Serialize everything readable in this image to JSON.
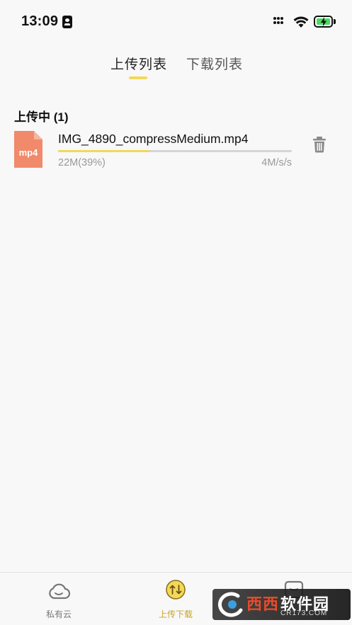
{
  "status_bar": {
    "time": "13:09"
  },
  "tabs": [
    {
      "label": "上传列表",
      "active": true
    },
    {
      "label": "下载列表",
      "active": false
    }
  ],
  "section": {
    "title": "上传中 (1)"
  },
  "uploads": [
    {
      "file_type": "mp4",
      "name": "IMG_4890_compressMedium.mp4",
      "progress_percent": 39,
      "size_text": "22M(39%)",
      "speed_text": "4M/s/s",
      "icon": "trash-icon"
    }
  ],
  "bottom_nav": [
    {
      "label": "私有云",
      "icon": "cloud-icon",
      "active": false
    },
    {
      "label": "上传下载",
      "icon": "transfer-icon",
      "active": true
    },
    {
      "label": "",
      "icon": "profile-icon",
      "active": false
    }
  ],
  "watermark": {
    "text_red": "西西",
    "text_white": "软件园",
    "sub": "CR173.COM"
  },
  "colors": {
    "accent": "#f3d85a",
    "file_icon": "#f08a6a",
    "background": "#f8f8f8"
  }
}
